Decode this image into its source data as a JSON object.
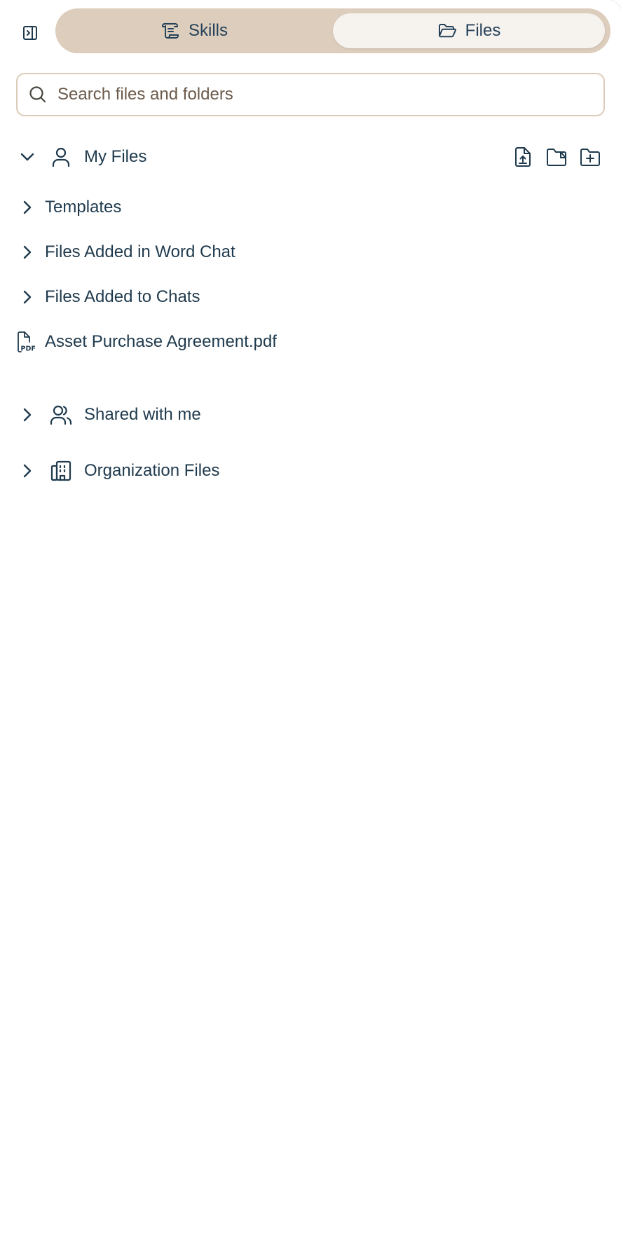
{
  "top_bar": {
    "collapse_icon": "sidebar-collapse-icon",
    "tabs": [
      {
        "label": "Skills",
        "icon": "scroll-icon",
        "selected": false
      },
      {
        "label": "Files",
        "icon": "folder-open-icon",
        "selected": true
      }
    ]
  },
  "search": {
    "placeholder": "Search files and folders",
    "value": "",
    "icon": "search-icon"
  },
  "tree": {
    "my_files": {
      "label": "My Files",
      "icon": "user-icon",
      "expanded": true,
      "actions": [
        {
          "name": "upload-file",
          "icon": "file-upload-icon"
        },
        {
          "name": "upload-folder",
          "icon": "folder-upload-icon"
        },
        {
          "name": "new-folder",
          "icon": "folder-plus-icon"
        }
      ],
      "children": [
        {
          "label": "Templates",
          "type": "folder"
        },
        {
          "label": "Files Added in Word Chat",
          "type": "folder"
        },
        {
          "label": "Files Added to Chats",
          "type": "folder"
        },
        {
          "label": "Asset Purchase Agreement.pdf",
          "type": "file",
          "icon": "pdf-file-icon"
        }
      ]
    },
    "shared": {
      "label": "Shared with me",
      "icon": "users-icon",
      "expanded": false
    },
    "organization": {
      "label": "Organization Files",
      "icon": "building-icon",
      "expanded": false
    }
  },
  "colors": {
    "accent_tan": "#ddcdbd",
    "selected_tab_bg": "#f6f2ee",
    "text": "#1f3a4d",
    "border": "#dccbb9"
  }
}
